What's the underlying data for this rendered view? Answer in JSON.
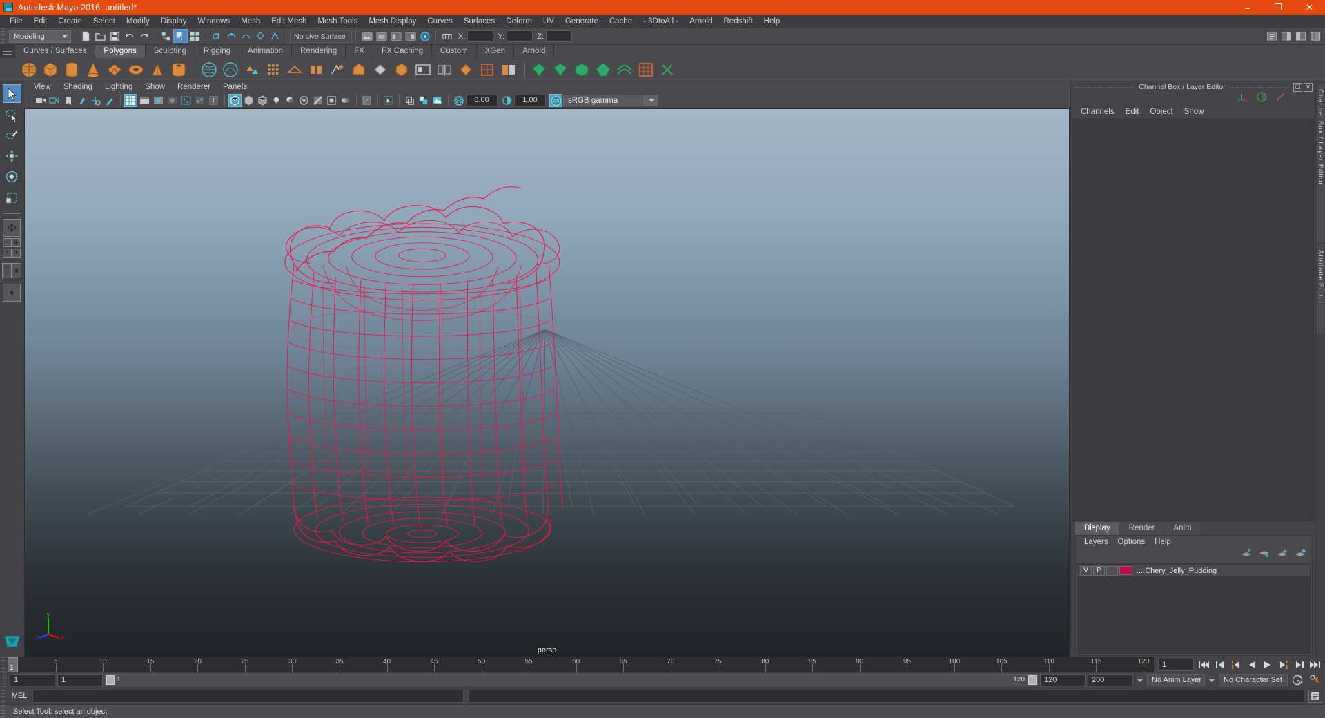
{
  "window": {
    "title": "Autodesk Maya 2016: untitled*",
    "app_icon": "maya-logo-icon",
    "minimize": "–",
    "maximize": "❐",
    "close": "✕",
    "accent_color": "#e64a0e"
  },
  "menubar": {
    "items": [
      "File",
      "Edit",
      "Create",
      "Select",
      "Modify",
      "Display",
      "Windows",
      "Mesh",
      "Edit Mesh",
      "Mesh Tools",
      "Mesh Display",
      "Curves",
      "Surfaces",
      "Deform",
      "UV",
      "Generate",
      "Cache",
      "- 3DtoAll -",
      "Arnold",
      "Redshift",
      "Help"
    ]
  },
  "statusline": {
    "selection_mode": "Modeling",
    "live_surface": "No Live Surface",
    "coord_labels": [
      "X:",
      "Y:",
      "Z:"
    ],
    "coord_values": [
      "",
      "",
      ""
    ]
  },
  "shelf": {
    "tabs": [
      "Curves / Surfaces",
      "Polygons",
      "Sculpting",
      "Rigging",
      "Animation",
      "Rendering",
      "FX",
      "FX Caching",
      "Custom",
      "XGen",
      "Arnold"
    ],
    "active_tab": "Polygons"
  },
  "toolbox": {
    "tools": [
      "select-tool",
      "lasso-select-tool",
      "paint-select-tool",
      "move-tool",
      "rotate-tool",
      "scale-tool"
    ],
    "active_tool": "select-tool"
  },
  "viewport": {
    "panel_menu": [
      "View",
      "Shading",
      "Lighting",
      "Show",
      "Renderer",
      "Panels"
    ],
    "exposure_value": "0.00",
    "gamma_value": "1.00",
    "color_management": "sRGB gamma",
    "color_management_enabled": "ON",
    "camera_label": "persp",
    "axis_labels": {
      "x": "x",
      "y": "y",
      "z": "z"
    },
    "axis_colors": {
      "x": "#e01010",
      "y": "#00d000",
      "z": "#2040ff"
    },
    "model_wireframe_color": "#e8194b"
  },
  "right_dock": {
    "header_title": "Channel Box / Layer Editor",
    "undock_icon": "undock-icon",
    "close_icon": "close-icon",
    "channelbox_menu": [
      "Channels",
      "Edit",
      "Object",
      "Show"
    ],
    "channelbox_icons": [
      "transform-axis-icon",
      "half-circle-icon",
      "slash-icon"
    ],
    "layer_tabs": [
      "Display",
      "Render",
      "Anim"
    ],
    "active_layer_tab": "Display",
    "layer_menu": [
      "Layers",
      "Options",
      "Help"
    ],
    "layer_buttons": [
      "move-layer-up-icon",
      "move-layer-down-icon",
      "new-layer-icon",
      "new-layer-from-selected-icon"
    ],
    "layers": [
      {
        "visibility": "V",
        "playback": "P",
        "shading": "",
        "color": "#b8104a",
        "name": "...:Chery_Jelly_Pudding"
      }
    ],
    "vertical_tabs": [
      "Channel Box / Layer Editor",
      "Attribute Editor"
    ]
  },
  "timeline": {
    "current_frame": "1",
    "current_frame_field": "1",
    "tick_labels": [
      "5",
      "10",
      "15",
      "20",
      "25",
      "30",
      "35",
      "40",
      "45",
      "50",
      "55",
      "60",
      "65",
      "70",
      "75",
      "80",
      "85",
      "90",
      "95",
      "100",
      "105",
      "110",
      "115",
      "120"
    ],
    "tick_values": [
      5,
      10,
      15,
      20,
      25,
      30,
      35,
      40,
      45,
      50,
      55,
      60,
      65,
      70,
      75,
      80,
      85,
      90,
      95,
      100,
      105,
      110,
      115,
      120
    ],
    "range_start": 1,
    "range_end": 120,
    "playback_buttons": [
      "go-to-start-icon",
      "step-back-keyframe-icon",
      "step-back-frame-icon",
      "play-backwards-icon",
      "play-forwards-icon",
      "step-forward-frame-icon",
      "step-forward-keyframe-icon",
      "go-to-end-icon"
    ]
  },
  "rangeslider": {
    "anim_start": "1",
    "range_start": "1",
    "slider_start_label": "1",
    "slider_end_label": "120",
    "range_end": "120",
    "anim_end": "200",
    "anim_layer": "No Anim Layer",
    "character_set": "No Character Set",
    "auto_key_icon": "auto-keyframe-icon",
    "anim_prefs_icon": "animation-preferences-icon"
  },
  "commandline": {
    "label": "MEL",
    "input_value": "",
    "input_placeholder": "",
    "script_editor_icon": "script-editor-icon"
  },
  "helpline": {
    "text": "Select Tool: select an object"
  }
}
